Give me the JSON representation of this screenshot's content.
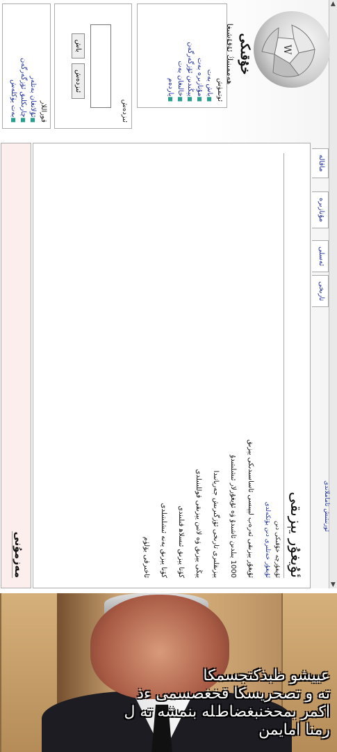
{
  "wiki": {
    "logo_name": "ﺧﯘﻗﯩﻜﻰ",
    "logo_tagline": "ﻫﻪﻣﻤﯩﻨﯩﯔ ﺋﯘﻗﯘﺷﯩﻐﺎ",
    "nav_box": {
      "title": "ﺋﻮﺗﻤﯜﺵ",
      "items": [
        "ﺑﺎﺵ ﺑﻪﺕ",
        "ﻣﯘﻧﺎﺯﯨﺮﻩ ﺑﻪﺕ",
        "ﻳﯧﯖﯩﺪﯨﻦ ﺋﯚﺯﮔﻪﺭﮔﻪﻥ",
        "ﺧﺎﻟﯩﻐﺎﻥ ﺑﻪﺕ",
        "ﻳﺎﺭﺩﻩﻡ"
      ]
    },
    "search_box": {
      "title": "ﺋﯩﺰﺩﻩﺵ",
      "go_label": "ﺑﺎﺵ",
      "search_label": "ﺋﯩﺰﺩﻩﺵ"
    },
    "tools_box": {
      "title": "ﻗﻮﺭﺍﻟﻼﺭ",
      "items": [
        "ﺋﯘﻻﻧﻐﺎﻥ ﺑﻪﺗﻠﻪﺭ",
        "ﭼﺎﺭﯨﻜﻠﯩﻖ ﺋﯚﺯﮔﻪﺭﮔﻪﻥ",
        "ﺑﻪﺕ ﻳﯜﻛﻠﻪﺵ"
      ]
    },
    "tabs": [
      "ﻣﺎﻗﺎﻟﻪ",
      "ﻣﯘﻧﺎﺯﯨﺮﻩ",
      "ﺋﻪﺳﻠﻰ",
      "ﺗﺎﺭﯨﺨﻰ"
    ],
    "article_title": "ﺋﯘﻳﻐﯘﺭ ﻳﯧﺰﯨﻘﻰ",
    "subtitle": "ﺋﯘﻳﻐﯘﺭﭼﻪ ﺧﯘﻗﯩﻜﻰ ﺩﯨﻦ",
    "redirect_note": "ﺋﯘﻳﻐﯘﺭ ﺧﻪﺗﻠﯩﺮﻯ ﺩﯨﻦ ﻳﯚﺗﻜﻪﻟﺪﻯ",
    "paragraphs": [
      "ﺋﯘﻳﻐﯘﺭ ﻳﯧﺰﯨﻘﻰ ﺋﻪﺭﻩﺏ ﻟﯧﭙﯩﺴﻰ ﺋﺎﺳﺎﺳﯩﺪﯨﻜﻰ ﻳﯧﺰﯨﻖ",
      "1000 ﻳﯩﻠﺪﯨﻦ ﺋﺎﺷﯩﺪﯗ ۋە ﺋﯘﻳﻐﯘﺭﻻﺭ ﺋﯩﺸﻠﯩﺘﯩﺪﯗ",
      "ﻳﯧﺰﯨﻘﻠﯩﺮﻯ ﺗﺎﺭﯨﺨﻰ ﺋﯚﺯﮔﯩﺮﯨﺶ ﺟﻪﺭﻳﺎﻧﯩﺪﺍ",
      "ﻳﯧﯖﻰ ﻳﯧﺰﯨﻖ ۋە ﻻﺗﯩﻦ ﻳﯧﺰﯨﻘﻰ ﻗﻮﻟﻠﯩﻨﯩﻠﺪﻯ",
      "ﻛﯚﻧﺎ ﻳﯧﺰﯨﻖ ﺋﯩﺴﻼﻫ ﻗﯩﻠﯩﻨﺪﻯ",
      "ﻛﯚﻧﺎ ﻳﯧﺰﯨﻖ ﻳﻪﻧﻪ ﺋﯩﺸﻠﯩﺘﯩﻠﺪﻯ",
      "ﺋﺎﺧﯩﺮﻗﻰ ﺑﯚﻟﯜﻡ"
    ],
    "side_links": [
      "ﺋﯘﻳﻐﯘﺭ ﺗﯩﻠﻰ",
      "ﺋﻪﺭﻩﺏ ﻳﯧﺰﯨﻘﻰ",
      "ﻻﺗﯩﻦ ﻳﯧﺰﯨﻘﻰ",
      "ﺋﯘﻳﻐﯘﺭ ﻛﻮﻣﭙﻴﯘﺗﯧﺮ ﻳﯧﺰﯨﻘﻰ"
    ],
    "bottom_heading": "ﻣﻪﺯﻣﯘﻧﻰ",
    "status_text": "ﺋﻮﺭﻧﯩﺘﯩﺶ ﺗﺎﻣﺎﻣﻼﻧﺪﻯ"
  },
  "meme": {
    "caption_lines": [
      "ﻋﻴﻴﺸﻮ ﻇﺒﺬﻛﺘﺠﺴﻤﻜﺎ",
      "ﺗﻪ ﻭ ﺗﺼﺤﺮﻳﺴﻜﺎ ﻗﺨﻐﺼﺴﻤﻰ ﺀﺫ",
      "ﺍﻛﻤﺮ ﺑﻤﺤﺨﻨﺒﻐﻀﺎﻁﻠﻪ ﺑﻨﻤﺸﻪ ﺗﻪ ﻝ",
      "ﺭﻣﻨﺎ ﺍﻣﺎﻳﻤﻦ"
    ]
  }
}
